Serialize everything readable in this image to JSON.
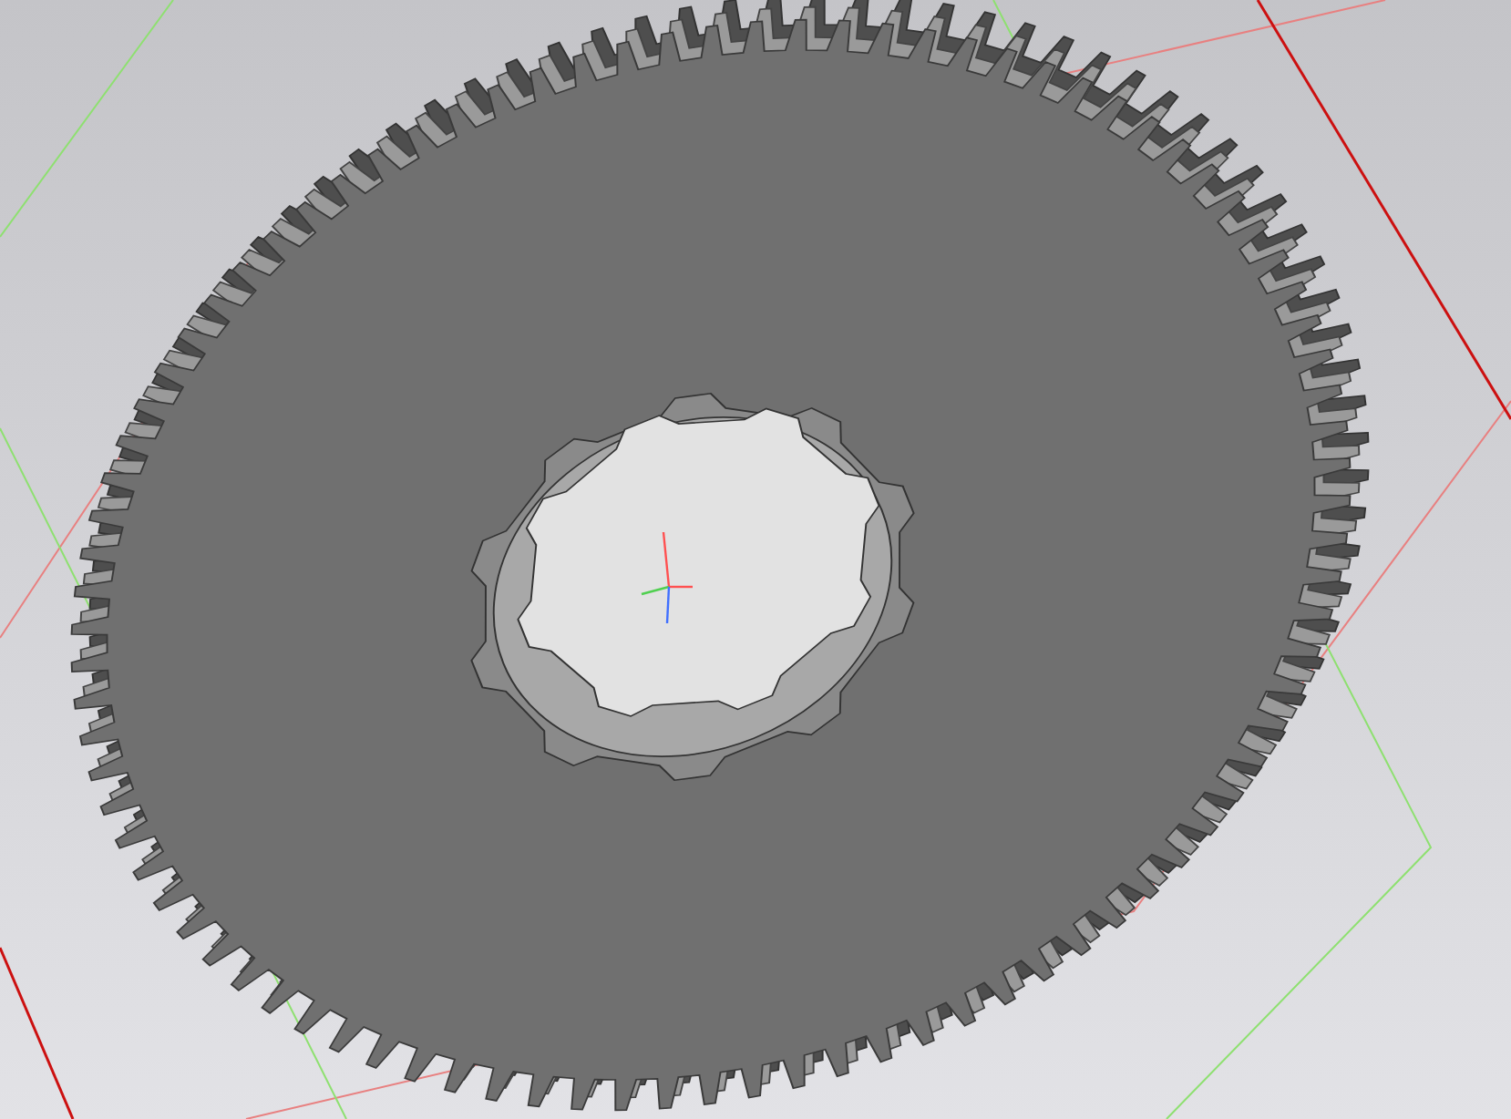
{
  "viewport": {
    "show_planes": true,
    "show_axes": true
  }
}
